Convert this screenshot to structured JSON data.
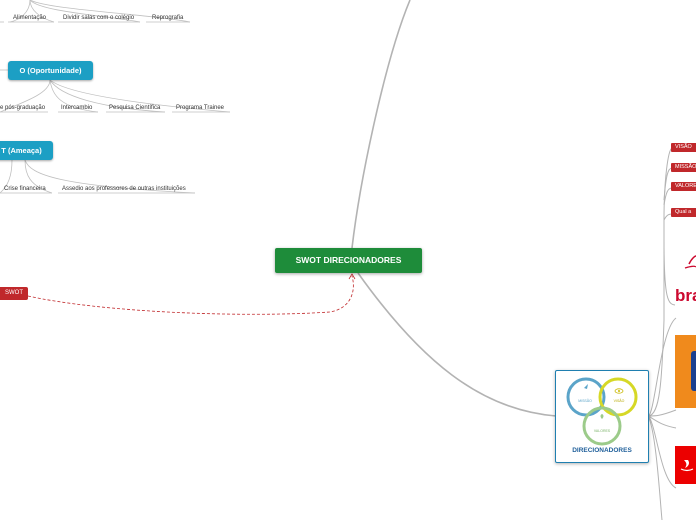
{
  "central": {
    "label": "SWOT DIRECIONADORES"
  },
  "swot_tag": {
    "label": "SWOT"
  },
  "branches": {
    "top_leaves": [
      "Alimentação",
      "Dividir salas com o colégio",
      "Reprografia"
    ],
    "opportunity": {
      "label": "O (Oportunidade)",
      "leaves": [
        "e pós-graduação",
        "Intercambio",
        "Pesquisa Científica",
        "Programa Trainee"
      ]
    },
    "threat": {
      "label": "T (Ameaça)",
      "leaves": [
        "Crise financeira",
        "Assedio aos professores de outras instituições"
      ]
    }
  },
  "right_tags": [
    "VISÃO",
    "MISSÃO",
    "VALORE",
    "Qual a"
  ],
  "direcionadores": {
    "title": "DIRECIONADORES",
    "circles": [
      "MISSÃO",
      "VISÃO",
      "VALORES"
    ]
  },
  "logos": [
    {
      "name": "bradesco",
      "text": "bra",
      "color": "#cc092f"
    },
    {
      "name": "orange-logo",
      "color": "#f08a1c"
    },
    {
      "name": "santander",
      "color": "#ec0000"
    }
  ],
  "colors": {
    "blue_topic": "#1c9fc4",
    "central": "#1e8c3a",
    "red": "#c0282b",
    "line": "#b3b3b3",
    "dashed": "#c0282b"
  }
}
